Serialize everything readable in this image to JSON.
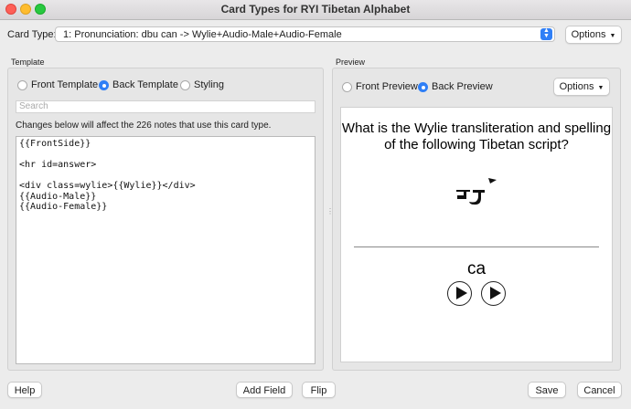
{
  "window": {
    "title": "Card Types for RYI Tibetan Alphabet"
  },
  "card_type": {
    "label": "Card Type:",
    "selected": "1: Pronunciation: dbu can -> Wylie+Audio-Male+Audio-Female",
    "options_label": "Options"
  },
  "template": {
    "group_label": "Template",
    "tabs": {
      "front": "Front Template",
      "back": "Back Template",
      "styling": "Styling",
      "selected": "back"
    },
    "search_placeholder": "Search",
    "notice": "Changes below will affect the 226 notes that use this card type.",
    "code": "{{FrontSide}}\n\n<hr id=answer>\n\n<div class=wylie>{{Wylie}}</div>\n{{Audio-Male}}\n{{Audio-Female}}"
  },
  "preview": {
    "group_label": "Preview",
    "tabs": {
      "front": "Front Preview",
      "back": "Back Preview",
      "selected": "back"
    },
    "options_label": "Options",
    "question": "What is the Wylie transliteration and spelling of the following Tibetan script?",
    "answer": "ca",
    "audio_buttons": [
      "play-male",
      "play-female"
    ]
  },
  "footer": {
    "help": "Help",
    "add_field": "Add Field",
    "flip": "Flip",
    "save": "Save",
    "cancel": "Cancel"
  },
  "colors": {
    "accent": "#2f7ff6",
    "close": "#fe5f57",
    "minimize": "#febc2e",
    "maximize": "#28c840"
  }
}
